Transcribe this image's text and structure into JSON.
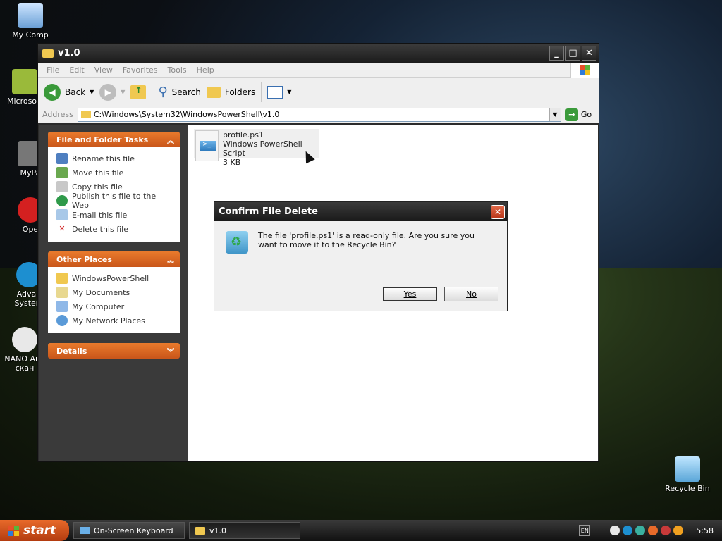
{
  "desktop": {
    "icons": [
      {
        "label": "My Comp"
      },
      {
        "label": "Microsoft"
      },
      {
        "label": "MyPa"
      },
      {
        "label": "Ope"
      },
      {
        "label": "Advan System"
      },
      {
        "label": "NANO Ант скан"
      },
      {
        "label": "Recycle Bin"
      }
    ]
  },
  "window": {
    "title": "v1.0",
    "menu": [
      "File",
      "Edit",
      "View",
      "Favorites",
      "Tools",
      "Help"
    ],
    "toolbar": {
      "back": "Back",
      "search": "Search",
      "folders": "Folders"
    },
    "address": {
      "label": "Address",
      "value": "C:\\Windows\\System32\\WindowsPowerShell\\v1.0",
      "go": "Go"
    },
    "taskpane": {
      "file_tasks": {
        "header": "File and Folder Tasks",
        "items": [
          "Rename this file",
          "Move this file",
          "Copy this file",
          "Publish this file to the Web",
          "E-mail this file",
          "Delete this file"
        ]
      },
      "other_places": {
        "header": "Other Places",
        "items": [
          "WindowsPowerShell",
          "My Documents",
          "My Computer",
          "My Network Places"
        ]
      },
      "details": {
        "header": "Details"
      }
    },
    "file": {
      "name": "profile.ps1",
      "type": "Windows PowerShell Script",
      "size": "3 KB"
    }
  },
  "dialog": {
    "title": "Confirm File Delete",
    "message": "The file 'profile.ps1' is a read-only file. Are you sure you want to move it to the Recycle Bin?",
    "yes": "Yes",
    "no": "No"
  },
  "taskbar": {
    "start": "start",
    "tasks": [
      "On-Screen Keyboard",
      "v1.0"
    ],
    "lang": "EN",
    "clock": "5:58"
  }
}
